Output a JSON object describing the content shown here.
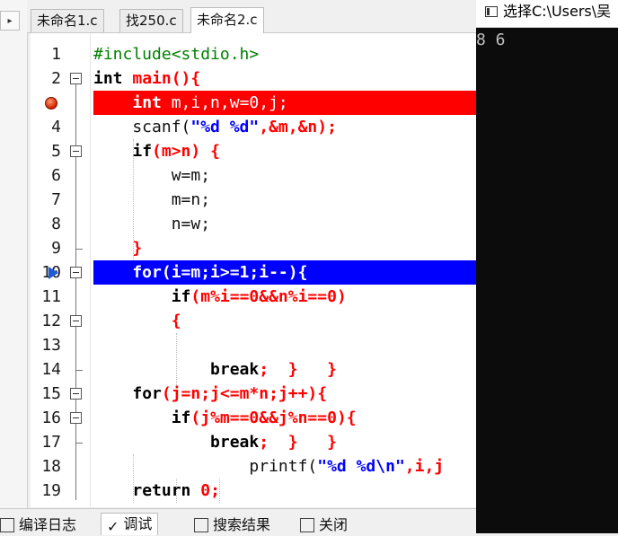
{
  "left_panel": {
    "arrow_glyph": "▸"
  },
  "editor_tabs": [
    {
      "label": "未命名1.c"
    },
    {
      "label": "找250.c"
    },
    {
      "label": "未命名2.c",
      "active": true
    }
  ],
  "line_numbers": [
    "1",
    "2",
    "3",
    "4",
    "5",
    "6",
    "7",
    "8",
    "9",
    "10",
    "11",
    "12",
    "13",
    "14",
    "15",
    "16",
    "17",
    "18",
    "19"
  ],
  "code": {
    "l1": "#include<stdio.h>",
    "l2_kw": "int",
    "l2_rest": " main(){",
    "l3_indent": "    ",
    "l3_kw": "int",
    "l3_rest": " m,i,n,w=0,j;",
    "l4_text": "    scanf(",
    "l4_str": "\"%d %d\"",
    "l4_rest": ",&m,&n);",
    "l5_indent": "    ",
    "l5_kw": "if",
    "l5_rest": "(m>n) {",
    "l6": "        w=m;",
    "l7": "        m=n;",
    "l8": "        n=w;",
    "l9": "    }",
    "l10": "    for(i=m;i>=1;i--){",
    "l11_indent": "        ",
    "l11_kw": "if",
    "l11_rest": "(m%i==0&&n%i==0)",
    "l12": "        {",
    "l13": "",
    "l14_indent": "            ",
    "l14_kw": "break",
    "l14_rest": ";  }   }",
    "l15_indent": "    ",
    "l15_kw": "for",
    "l15_rest": "(j=n;j<=m*n;j++){",
    "l16_indent": "        ",
    "l16_kw": "if",
    "l16_rest": "(j%m==0&&j%n==0){",
    "l17_indent": "            ",
    "l17_kw": "break",
    "l17_rest": ";  }   }",
    "l18_text": "                printf(",
    "l18_str": "\"%d %d\\n\"",
    "l18_rest": ",i,j",
    "l19_indent": "    ",
    "l19_kw": "return",
    "l19_rest": " 0;"
  },
  "bottom_tabs": [
    {
      "label": "编译日志"
    },
    {
      "label": "调试",
      "active": true
    },
    {
      "label": "搜索结果"
    },
    {
      "label": "关闭"
    }
  ],
  "console": {
    "title": "选择C:\\Users\\吴",
    "output": "8 6"
  },
  "colors": {
    "breakpoint_line": "#ff0000",
    "current_line": "#0000ff",
    "console_bg": "#0c0c0c"
  }
}
